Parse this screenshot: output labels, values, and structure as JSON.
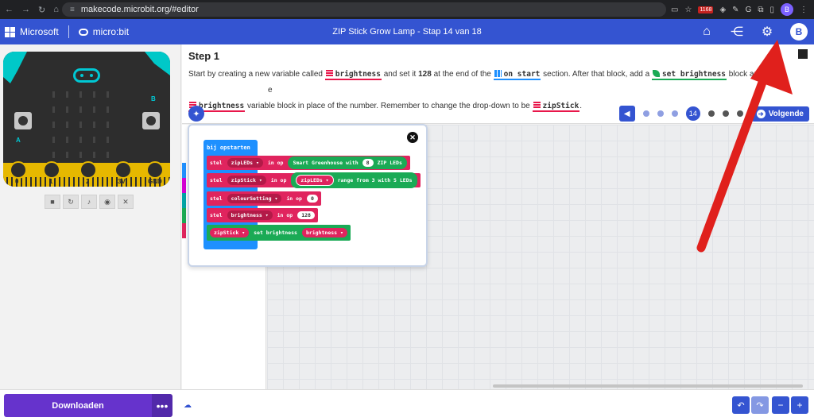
{
  "browser": {
    "url": "makecode.microbit.org/#editor",
    "extension_badge": "1168",
    "profile_initial": "B"
  },
  "header": {
    "brand_microsoft": "Microsoft",
    "brand_microbit": "micro:bit",
    "title": "ZIP Stick Grow Lamp - Stap 14 van 18",
    "avatar_initial": "B"
  },
  "simulator": {
    "labels": {
      "a": "A",
      "b": "B"
    },
    "pins": [
      "0",
      "1",
      "2",
      "3V",
      "GND"
    ]
  },
  "tutorial": {
    "step_title": "Step 1",
    "text": {
      "p1": "Start by creating a new variable called ",
      "kw_brightness": "brightness",
      "p2": " and set it ",
      "value_128": "128",
      "p3": " at the end of the ",
      "kw_on_start": "on start",
      "p4": " section. After that block, add a ",
      "kw_set_brightness": "set brightness",
      "p5": " block and",
      "p6": "e",
      "kw_brightness2": "brightness",
      "p7": " variable block in place of the number. Remember to change the drop-down to be ",
      "kw_zipstick": "zipStick",
      "p8": "."
    },
    "current_step": "14",
    "next_label": "Volgende"
  },
  "hint": {
    "on_start_label": "bij opstarten",
    "blocks": [
      {
        "keyword": "stel",
        "var": "zipLEDs ▾",
        "op": "in op",
        "value": "Smart Greenhouse with",
        "num": "8",
        "suffix": "ZIP LEDs"
      },
      {
        "keyword": "stel",
        "var": "zipStick ▾",
        "op": "in op",
        "inner": "zipLEDs ▾",
        "value": "range from 3 with 5 LEDs"
      },
      {
        "keyword": "stel",
        "var": "colourSetting ▾",
        "op": "in op",
        "num": "0"
      },
      {
        "keyword": "stel",
        "var": "brightness ▾",
        "op": "in op",
        "num": "128"
      },
      {
        "target": "zipStick ▾",
        "action": "set brightness",
        "arg": "brightness ▾"
      }
    ]
  },
  "bottom": {
    "download_label": "Downloaden",
    "more_label": "•••"
  },
  "colors": {
    "accent": "#3454d1",
    "download": "#6633cc",
    "variables": "#e0245e",
    "leds": "#1aaa55",
    "loops": "#1e90ff",
    "arrow": "#e0201c"
  },
  "icons": [
    "home-icon",
    "share-icon",
    "settings-gear-icon",
    "lightbulb-icon",
    "close-icon",
    "undo-icon",
    "redo-icon",
    "zoom-out-icon",
    "zoom-in-icon",
    "cloud-icon"
  ]
}
